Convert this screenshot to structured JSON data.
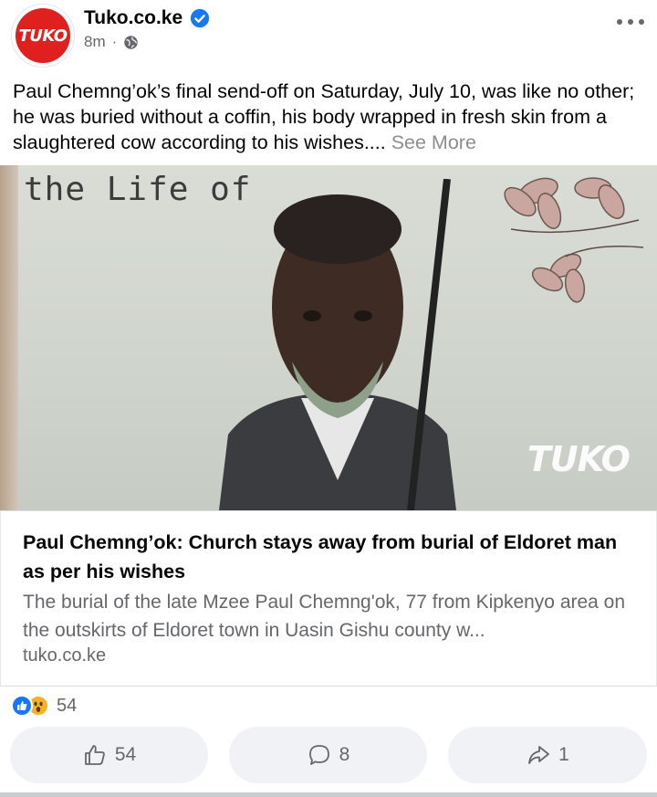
{
  "header": {
    "avatar_label": "TUKO",
    "page_name": "Tuko.co.ke",
    "time": "8m",
    "separator": "·"
  },
  "post": {
    "text": "Paul Chemng’ok’s final send-off on Saturday, July 10, was like no other; he was buried without a coffin, his body wrapped in fresh skin from a slaughtered cow according to his wishes....",
    "see_more": "See More"
  },
  "image": {
    "book_text": "the Life of",
    "watermark": "TUKO"
  },
  "link_preview": {
    "title": "Paul Chemng’ok: Church stays away from burial of Eldoret man as per his wishes",
    "description": "The burial of the late Mzee Paul Chemng'ok, 77 from Kipkenyo area on the outskirts of Eldoret town in Uasin Gishu county w...",
    "domain": "tuko.co.ke"
  },
  "reactions": {
    "count": "54",
    "types": [
      "like",
      "wow"
    ]
  },
  "actions": {
    "like_count": "54",
    "comment_count": "8",
    "share_count": "1"
  },
  "colors": {
    "brand_red": "#e0201f",
    "facebook_blue": "#1877f2",
    "secondary_text": "#65676b",
    "button_bg": "#f0f2f5"
  }
}
